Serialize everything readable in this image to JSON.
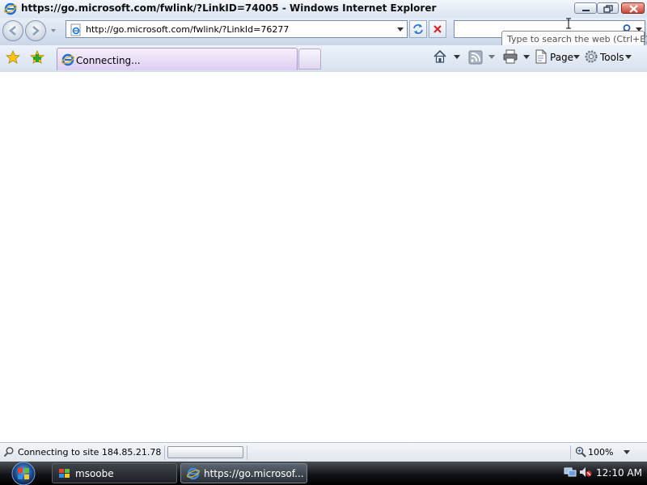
{
  "window": {
    "title": "https://go.microsoft.com/fwlink/?LinkID=74005 - Windows Internet Explorer"
  },
  "navbar": {
    "address": "http://go.microsoft.com/fwlink/?LinkId=76277",
    "search_tooltip": "Type to search the web (Ctrl+E)"
  },
  "tabs": [
    {
      "label": "Connecting..."
    }
  ],
  "commandbar": {
    "page_label": "Page",
    "tools_label": "Tools"
  },
  "statusbar": {
    "status_text": "Connecting to site 184.85.21.78",
    "zoom": "100%"
  },
  "taskbar": {
    "items": [
      {
        "label": "msoobe"
      },
      {
        "label": "https://go.microsof..."
      }
    ],
    "clock": "12:10 AM"
  },
  "colors": {
    "tab_active": "#dccdf2",
    "close_button": "#c8473a"
  }
}
